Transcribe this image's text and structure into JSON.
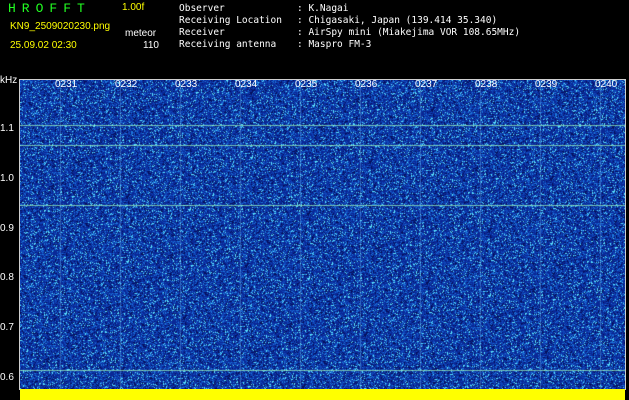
{
  "header": {
    "app_title": "HROFFT",
    "version": "1.00f",
    "filename": "KN9_2509020230.png",
    "datetime": "25.09.02 02:30",
    "mode": "meteor",
    "count": "110"
  },
  "info": [
    {
      "label": "Observer",
      "value": ": K.Nagai"
    },
    {
      "label": "Receiving Location",
      "value": ": Chigasaki, Japan (139.414 35.340)"
    },
    {
      "label": "Receiver",
      "value": ": AirSpy mini (Miakejima VOR 108.65MHz)"
    },
    {
      "label": "Receiving antenna",
      "value": ": Maspro FM-3"
    }
  ],
  "y_axis": {
    "unit": "kHz",
    "ticks": [
      "1.1",
      "1.0",
      "0.9",
      "0.8",
      "0.7",
      "0.6"
    ]
  },
  "time_labels": [
    "0231",
    "0232",
    "0233",
    "0234",
    "0235",
    "0236",
    "0237",
    "0238",
    "0239",
    "0240"
  ],
  "colors": {
    "background": "#000000",
    "spectrogram": "#0a2a9a",
    "accent_green": "#22ff22",
    "accent_yellow": "#ffff00",
    "accent_cyan": "#5fe8ff"
  }
}
